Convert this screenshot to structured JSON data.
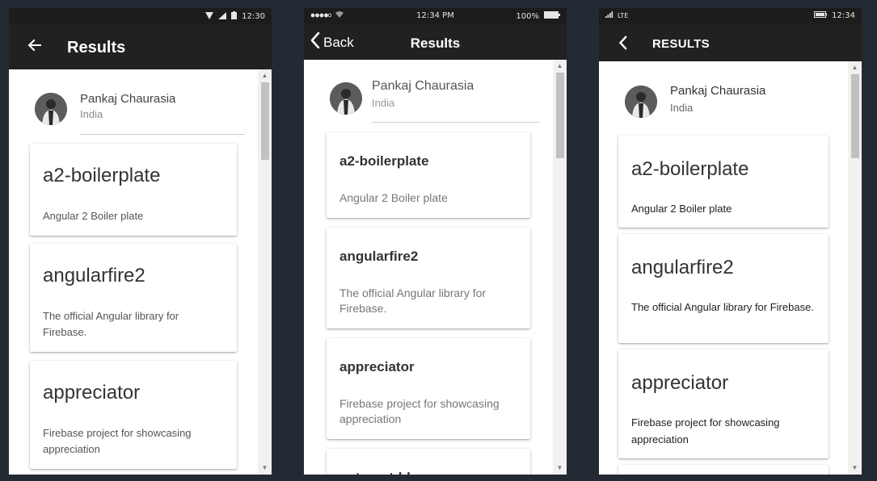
{
  "screens": [
    {
      "status": {
        "time": "12:30"
      },
      "appbar": {
        "title": "Results"
      },
      "profile": {
        "name": "Pankaj Chaurasia",
        "country": "India"
      },
      "cards": [
        {
          "title": "a2-boilerplate",
          "description": "Angular 2 Boiler plate"
        },
        {
          "title": "angularfire2",
          "description": "The official Angular library for Firebase."
        },
        {
          "title": "appreciator",
          "description": "Firebase project for showcasing appreciation"
        }
      ]
    },
    {
      "status": {
        "time": "12:34 PM",
        "battery": "100%"
      },
      "appbar": {
        "title": "Results",
        "back_label": "Back"
      },
      "profile": {
        "name": "Pankaj Chaurasia",
        "country": "India"
      },
      "cards": [
        {
          "title": "a2-boilerplate",
          "description": "Angular 2 Boiler plate"
        },
        {
          "title": "angularfire2",
          "description": "The official Angular library for Firebase."
        },
        {
          "title": "appreciator",
          "description": "Firebase project for showcasing appreciation"
        },
        {
          "title": "autocrat-blog",
          "description": ""
        }
      ]
    },
    {
      "status": {
        "time": "12:34",
        "network": "LTE"
      },
      "appbar": {
        "title": "RESULTS"
      },
      "profile": {
        "name": "Pankaj Chaurasia",
        "country": "India"
      },
      "cards": [
        {
          "title": "a2-boilerplate",
          "description": "Angular 2 Boiler plate"
        },
        {
          "title": "angularfire2",
          "description": "The official Angular library for Firebase."
        },
        {
          "title": "appreciator",
          "description": "Firebase project for showcasing appreciation"
        }
      ]
    }
  ],
  "icons": {
    "android_back": "arrow-back-icon",
    "ios_back": "chevron-left-icon",
    "windows_back": "chevron-left-icon"
  },
  "colors": {
    "appbar": "#212121",
    "background": "#242a33"
  }
}
